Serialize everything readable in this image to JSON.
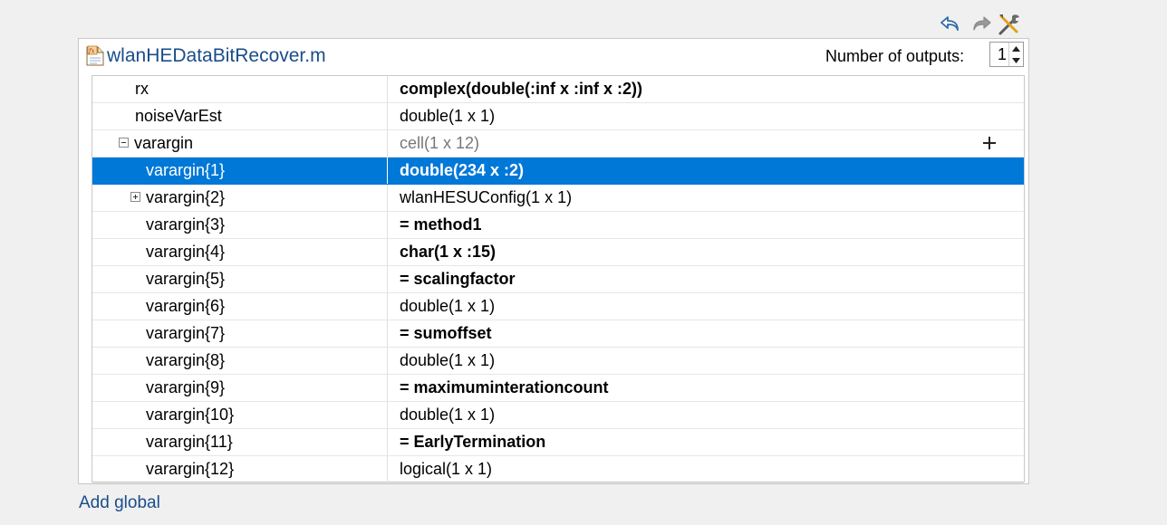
{
  "toolbar": {
    "undo_icon": "undo-icon",
    "redo_icon": "redo-icon",
    "settings_icon": "tools-icon"
  },
  "header": {
    "file_name": "wlanHEDataBitRecover.m",
    "outputs_label": "Number of outputs:",
    "outputs_value": "1"
  },
  "table": {
    "rows": [
      {
        "name": "rx",
        "value": "complex(double(:inf x :inf x :2))",
        "value_style": "bold",
        "tree": "none",
        "indent": 0
      },
      {
        "name": "noiseVarEst",
        "value": "double(1 x 1)",
        "value_style": "normal",
        "tree": "none",
        "indent": 0
      },
      {
        "name": "varargin",
        "value": "cell(1 x 12)",
        "value_style": "gray",
        "tree": "minus",
        "indent": 0,
        "add_button": true
      },
      {
        "name": "varargin{1}",
        "value": "double(234 x :2)",
        "value_style": "bold",
        "tree": "none",
        "indent": 1,
        "selected": true
      },
      {
        "name": "varargin{2}",
        "value": "wlanHESUConfig(1 x 1)",
        "value_style": "normal",
        "tree": "plus",
        "indent": 1
      },
      {
        "name": "varargin{3}",
        "value": "= method1",
        "value_style": "bold",
        "tree": "none",
        "indent": 1
      },
      {
        "name": "varargin{4}",
        "value": "char(1 x :15)",
        "value_style": "bold",
        "tree": "none",
        "indent": 1
      },
      {
        "name": "varargin{5}",
        "value": "= scalingfactor",
        "value_style": "bold",
        "tree": "none",
        "indent": 1
      },
      {
        "name": "varargin{6}",
        "value": "double(1 x 1)",
        "value_style": "normal",
        "tree": "none",
        "indent": 1
      },
      {
        "name": "varargin{7}",
        "value": "= sumoffset",
        "value_style": "bold",
        "tree": "none",
        "indent": 1
      },
      {
        "name": "varargin{8}",
        "value": "double(1 x 1)",
        "value_style": "normal",
        "tree": "none",
        "indent": 1
      },
      {
        "name": "varargin{9}",
        "value": "= maximuminterationcount",
        "value_style": "bold",
        "tree": "none",
        "indent": 1
      },
      {
        "name": "varargin{10}",
        "value": "double(1 x 1)",
        "value_style": "normal",
        "tree": "none",
        "indent": 1
      },
      {
        "name": "varargin{11}",
        "value": "= EarlyTermination",
        "value_style": "bold",
        "tree": "none",
        "indent": 1
      },
      {
        "name": "varargin{12}",
        "value": "logical(1 x 1)",
        "value_style": "normal",
        "tree": "none",
        "indent": 1
      }
    ]
  },
  "footer": {
    "add_global_label": "Add global"
  },
  "colors": {
    "selection": "#0078d7",
    "link": "#1a4d8a"
  }
}
